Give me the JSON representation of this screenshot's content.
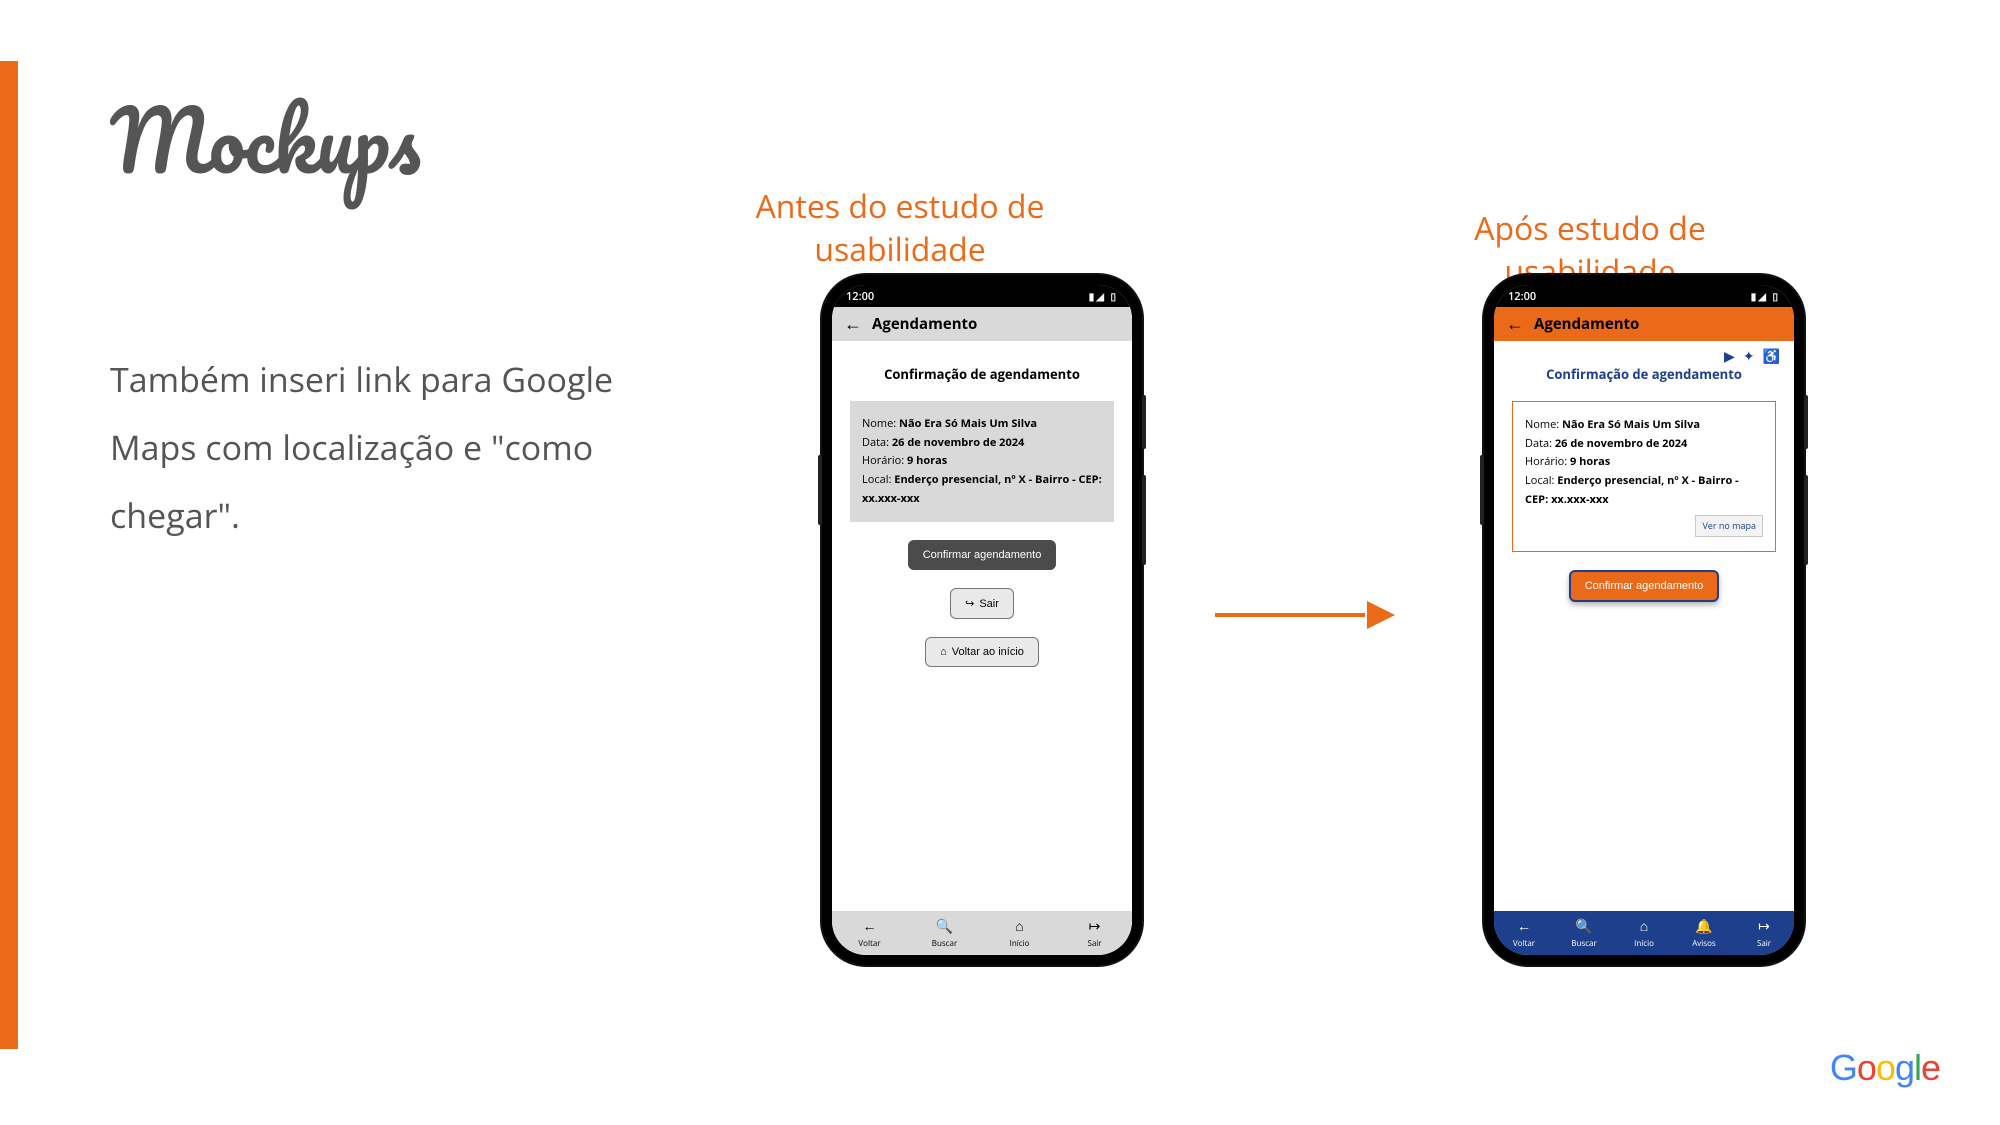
{
  "slide": {
    "title": "Mockups",
    "body": "Também inseri link para Google Maps com localização e \"como chegar\"."
  },
  "captions": {
    "before": "Antes do estudo de usabilidade",
    "after": "Após estudo de usabilidade"
  },
  "status": {
    "time": "12:00"
  },
  "appbar": {
    "title": "Agendamento"
  },
  "screen": {
    "heading": "Confirmação de agendamento",
    "labels": {
      "nome": "Nome:",
      "data": "Data:",
      "horario": "Horário:",
      "local": "Local:"
    },
    "values": {
      "nome": "Não Era Só Mais Um Silva",
      "data": "26 de novembro de 2024",
      "horario": "9 horas",
      "local": "Enderço presencial, nº X - Bairro - CEP: xx.xxx-xxx"
    },
    "map_link": "Ver no mapa",
    "confirm": "Confirmar agendamento",
    "exit": "Sair",
    "home": "Voltar ao início"
  },
  "nav": {
    "voltar": "Voltar",
    "buscar": "Buscar",
    "inicio": "Início",
    "avisos": "Avisos",
    "sair": "Sair"
  },
  "footer": {
    "g1": "G",
    "g2": "o",
    "g3": "o",
    "g4": "g",
    "g5": "l",
    "g6": "e"
  }
}
